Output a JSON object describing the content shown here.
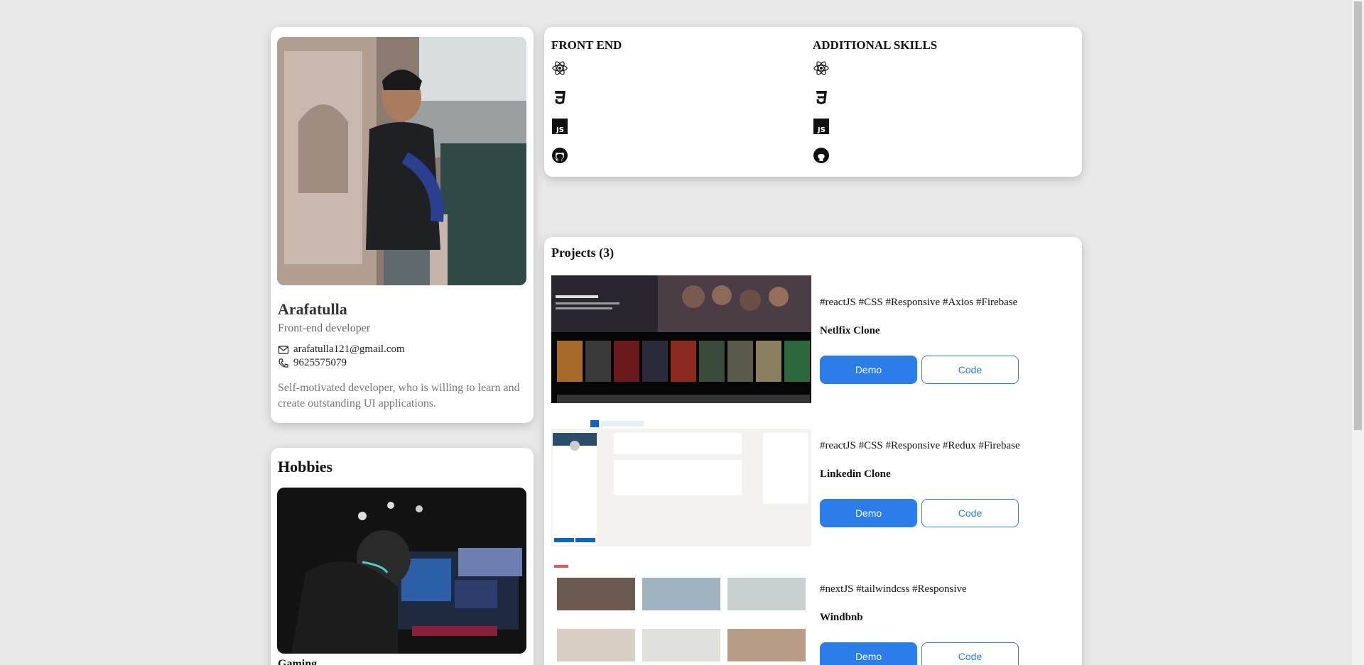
{
  "profile": {
    "name": "Arafatulla",
    "role": "Front-end developer",
    "email": "arafatulla121@gmail.com",
    "phone": "9625575079",
    "bio": "Self-motivated developer, who is willing to learn and create outstanding UI applications."
  },
  "hobbies": {
    "title": "Hobbies",
    "caption": "Gaming"
  },
  "skills": {
    "front_end_title": "FRONT END",
    "additional_title": "ADDITIONAL SKILLS",
    "icons": [
      "react-icon",
      "css3-icon",
      "javascript-icon",
      "github-icon"
    ]
  },
  "projects": {
    "title": "Projects (3)",
    "items": [
      {
        "tags": "#reactJS #CSS #Responsive #Axios #Firebase",
        "name": "Netlfix Clone",
        "demo": "Demo",
        "code": "Code"
      },
      {
        "tags": "#reactJS #CSS #Responsive #Redux #Firebase",
        "name": "Linkedin Clone",
        "demo": "Demo",
        "code": "Code"
      },
      {
        "tags": "#nextJS #tailwindcss #Responsive",
        "name": "Windbnb",
        "demo": "Demo",
        "code": "Code"
      }
    ]
  },
  "colors": {
    "accent": "#2b7de9",
    "background": "#e9e9e9"
  }
}
